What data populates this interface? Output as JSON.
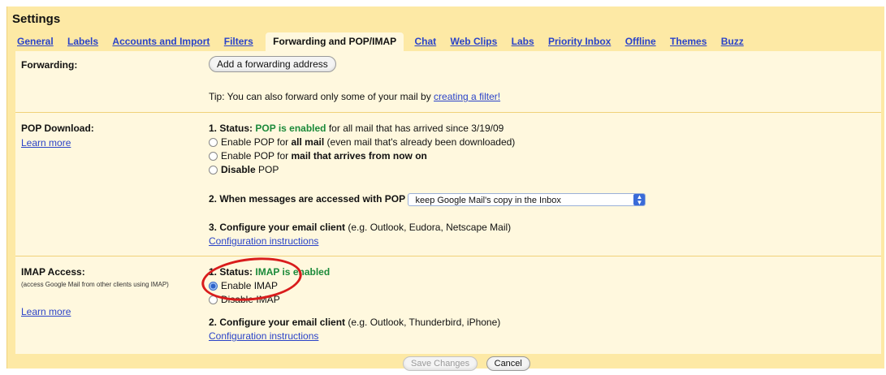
{
  "header": {
    "title": "Settings"
  },
  "tabs": [
    {
      "label": "General"
    },
    {
      "label": "Labels"
    },
    {
      "label": "Accounts and Import"
    },
    {
      "label": "Filters"
    },
    {
      "label": "Forwarding and POP/IMAP",
      "active": true
    },
    {
      "label": "Chat"
    },
    {
      "label": "Web Clips"
    },
    {
      "label": "Labs"
    },
    {
      "label": "Priority Inbox"
    },
    {
      "label": "Offline"
    },
    {
      "label": "Themes"
    },
    {
      "label": "Buzz"
    }
  ],
  "forwarding": {
    "label": "Forwarding:",
    "add_button": "Add a forwarding address",
    "tip_prefix": "Tip: You can also forward only some of your mail by ",
    "tip_link": "creating a filter!"
  },
  "pop": {
    "label": "POP Download:",
    "learn_more": "Learn more",
    "status_prefix": "1. Status: ",
    "status_value": "POP is enabled",
    "status_suffix": " for all mail that has arrived since 3/19/09",
    "options": [
      {
        "pre": "Enable POP for ",
        "bold": "all mail",
        "post": " (even mail that's already been downloaded)"
      },
      {
        "pre": "Enable POP for ",
        "bold": "mail that arrives from now on",
        "post": ""
      },
      {
        "pre": "",
        "bold": "Disable",
        "post": " POP"
      }
    ],
    "access_label": "2. When messages are accessed with POP",
    "access_select": "keep Google Mail's copy in the Inbox",
    "configure_label": "3. Configure your email client",
    "configure_hint": " (e.g. Outlook, Eudora, Netscape Mail)",
    "config_link": "Configuration instructions"
  },
  "imap": {
    "label": "IMAP Access:",
    "note": "(access Google Mail from other clients using IMAP)",
    "learn_more": "Learn more",
    "status_prefix": "1. Status: ",
    "status_value": "IMAP is enabled",
    "options": [
      {
        "label": "Enable IMAP",
        "checked": true
      },
      {
        "label": "Disable IMAP",
        "checked": false
      }
    ],
    "configure_label": "2. Configure your email client",
    "configure_hint": " (e.g. Outlook, Thunderbird, iPhone)",
    "config_link": "Configuration instructions"
  },
  "footer": {
    "save_label": "Save Changes",
    "cancel_label": "Cancel"
  },
  "colors": {
    "background": "#fde9a5",
    "panel": "#fff8de",
    "link": "#2a43c8",
    "status_green": "#1b8a3a",
    "annotation_red": "#d91c1c"
  }
}
